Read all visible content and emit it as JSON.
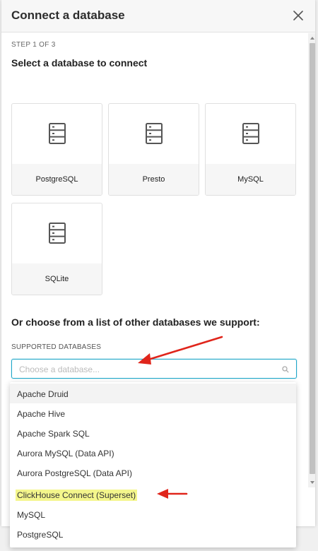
{
  "modal": {
    "title": "Connect a database",
    "step_label": "STEP 1 OF 3",
    "step_title": "Select a database to connect"
  },
  "cards": [
    {
      "label": "PostgreSQL",
      "icon": "database-icon"
    },
    {
      "label": "Presto",
      "icon": "database-icon"
    },
    {
      "label": "MySQL",
      "icon": "database-icon"
    },
    {
      "label": "SQLite",
      "icon": "database-icon"
    }
  ],
  "other": {
    "title": "Or choose from a list of other databases we support:",
    "supported_label": "SUPPORTED DATABASES",
    "placeholder": "Choose a database...",
    "value": ""
  },
  "dropdown": {
    "options": [
      "Apache Druid",
      "Apache Hive",
      "Apache Spark SQL",
      "Aurora MySQL (Data API)",
      "Aurora PostgreSQL (Data API)",
      "ClickHouse Connect (Superset)",
      "MySQL",
      "PostgreSQL"
    ],
    "active_index": 0,
    "highlighted_index": 5
  },
  "colors": {
    "focus_border": "#20a7c9",
    "highlight": "#f4f68c",
    "annotation_arrow": "#e0251b"
  }
}
